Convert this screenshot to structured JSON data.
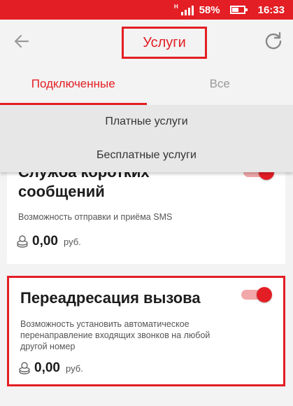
{
  "status_bar": {
    "network": "H",
    "battery": "58%",
    "time": "16:33",
    "battery_level": 0.58
  },
  "header": {
    "title": "Услуги"
  },
  "tabs": [
    {
      "label": "Подключенные",
      "active": true
    },
    {
      "label": "Все",
      "active": false
    }
  ],
  "dropdown": {
    "options": [
      "Платные услуги",
      "Бесплатные услуги"
    ]
  },
  "services": [
    {
      "title": "Служба коротких сообщений",
      "description": "Возможность отправки и приёма SMS",
      "price": "0,00",
      "currency": "руб.",
      "enabled": true
    },
    {
      "title": "Переадресация вызова",
      "description": "Возможность установить автоматическое перенаправление входящих звонков на любой другой номер",
      "price": "0,00",
      "currency": "руб.",
      "enabled": true
    }
  ],
  "colors": {
    "accent": "#e31e24",
    "background": "#f3f3f3",
    "dropdown": "#e7e7e7"
  }
}
